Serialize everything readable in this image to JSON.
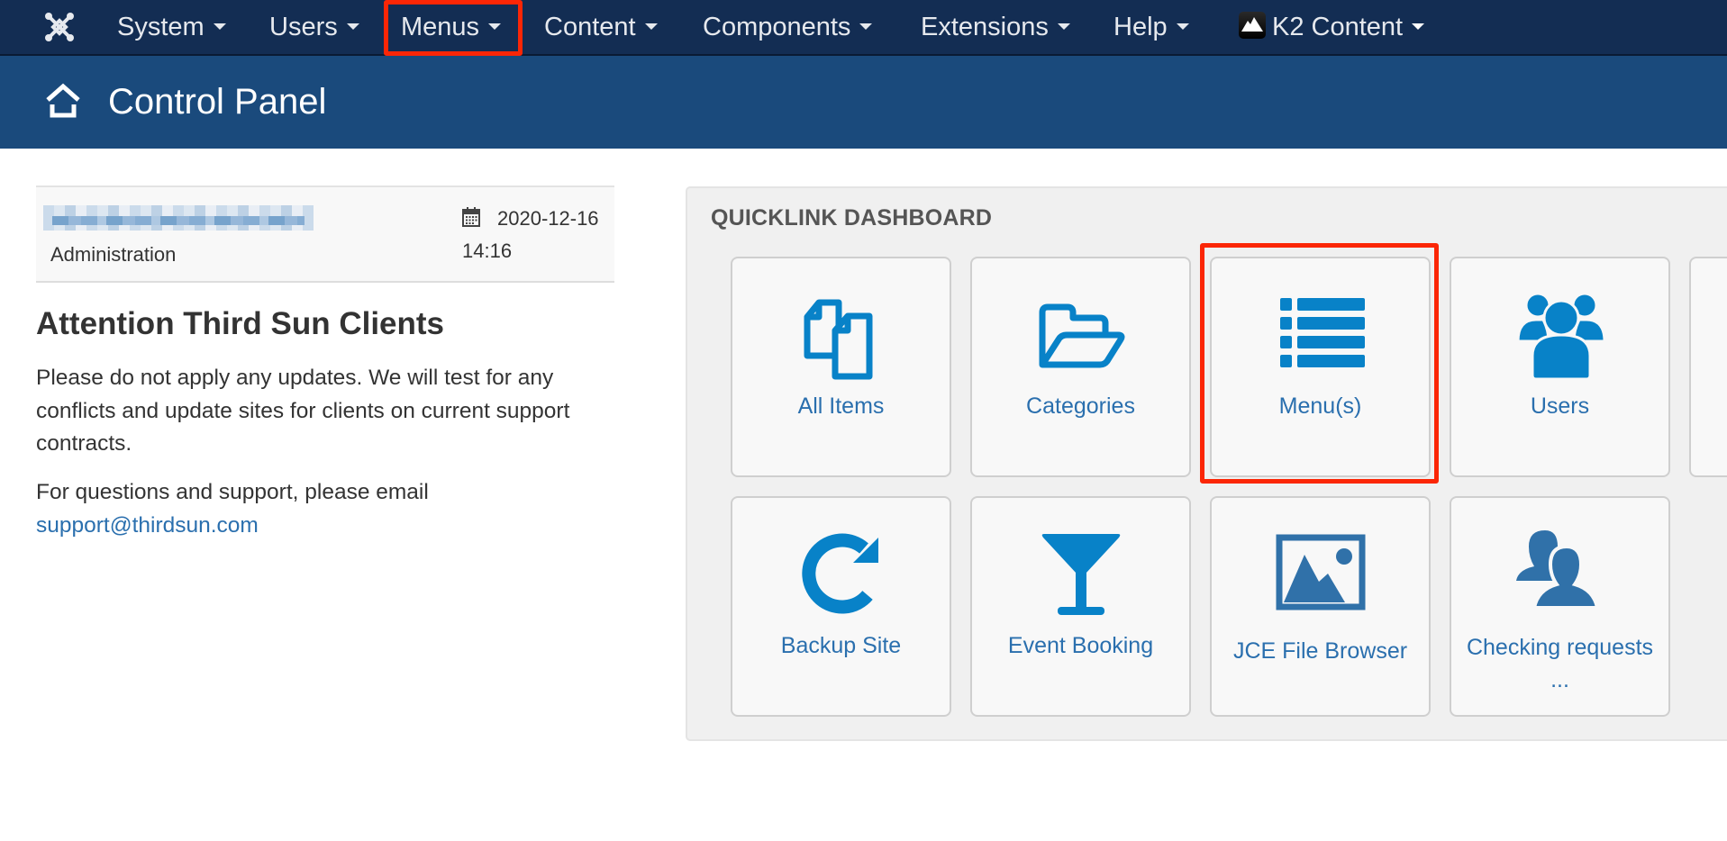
{
  "navbar": {
    "logo": "joomla-logo",
    "items": [
      {
        "label": "System",
        "has_dropdown": true
      },
      {
        "label": "Users",
        "has_dropdown": true
      },
      {
        "label": "Menus",
        "has_dropdown": true,
        "highlighted": true
      },
      {
        "label": "Content",
        "has_dropdown": true
      },
      {
        "label": "Components",
        "has_dropdown": true
      },
      {
        "label": "Extensions",
        "has_dropdown": true
      },
      {
        "label": "Help",
        "has_dropdown": true
      },
      {
        "label": "K2 Content",
        "has_dropdown": true,
        "icon": "k2-mountain-icon"
      }
    ]
  },
  "header": {
    "icon": "home-icon",
    "title": "Control Panel"
  },
  "info_box": {
    "user_name": "[blurred]",
    "role": "Administration",
    "date": "2020-12-16",
    "time": "14:16",
    "date_icon": "calendar-icon"
  },
  "notice": {
    "heading": "Attention Third Sun Clients",
    "paragraph1": "Please do not apply any updates.  We will test for any conflicts and update sites for clients on current support contracts.",
    "paragraph2": "For questions and support, please email",
    "email": "support@thirdsun.com"
  },
  "quicklinks": {
    "title": "QUICKLINK DASHBOARD",
    "tiles": [
      {
        "label": "All Items",
        "icon": "copy-documents-icon"
      },
      {
        "label": "Categories",
        "icon": "folder-open-icon"
      },
      {
        "label": "Menu(s)",
        "icon": "list-icon",
        "highlighted": true
      },
      {
        "label": "Users",
        "icon": "users-group-icon"
      },
      {
        "label": "",
        "icon": ""
      },
      {
        "label": "Backup Site",
        "icon": "refresh-icon"
      },
      {
        "label": "Event Booking",
        "icon": "cocktail-glass-icon"
      },
      {
        "label": "JCE File Browser",
        "icon": "image-icon"
      },
      {
        "label": "Checking requests ...",
        "icon": "two-users-icon"
      }
    ]
  },
  "colors": {
    "navbar_bg": "#132d53",
    "header_bg": "#1a4a7c",
    "icon_blue": "#0882c8",
    "icon_dark_blue": "#3071a9",
    "link_blue": "#2a6fae",
    "highlight_red": "#fb2606",
    "panel_bg": "#f0f0f0",
    "tile_bg": "#f8f8f8"
  }
}
